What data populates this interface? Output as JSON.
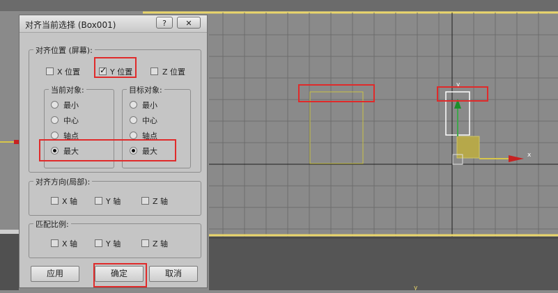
{
  "dialog": {
    "title": "对齐当前选择 (Box001)",
    "help_label": "?",
    "close_label": "✕"
  },
  "align_position": {
    "title": "对齐位置 (屏幕):",
    "x_label": "X 位置",
    "y_label": "Y 位置",
    "z_label": "Z 位置",
    "x_checked": false,
    "y_checked": true,
    "z_checked": false
  },
  "current_object": {
    "title": "当前对象:",
    "options": [
      "最小",
      "中心",
      "轴点",
      "最大"
    ],
    "selected": "最大"
  },
  "target_object": {
    "title": "目标对象:",
    "options": [
      "最小",
      "中心",
      "轴点",
      "最大"
    ],
    "selected": "最大"
  },
  "align_orientation": {
    "title": "对齐方向(局部):",
    "x_label": "X 轴",
    "y_label": "Y 轴",
    "z_label": "Z 轴"
  },
  "match_scale": {
    "title": "匹配比例:",
    "x_label": "X 轴",
    "y_label": "Y 轴",
    "z_label": "Z 轴"
  },
  "buttons": {
    "apply": "应用",
    "ok": "确定",
    "cancel": "取消"
  },
  "viewport": {
    "axis_x_label": "x",
    "axis_y_label": "y",
    "colors": {
      "background": "#8a8a8a",
      "grid": "#6d6d6d",
      "axis_line": "#1e1e1e",
      "target_box": "#c9c247",
      "selected_box": "#ffffff",
      "highlight": "#e02a2a",
      "border_yellow": "#e9d56a"
    }
  }
}
